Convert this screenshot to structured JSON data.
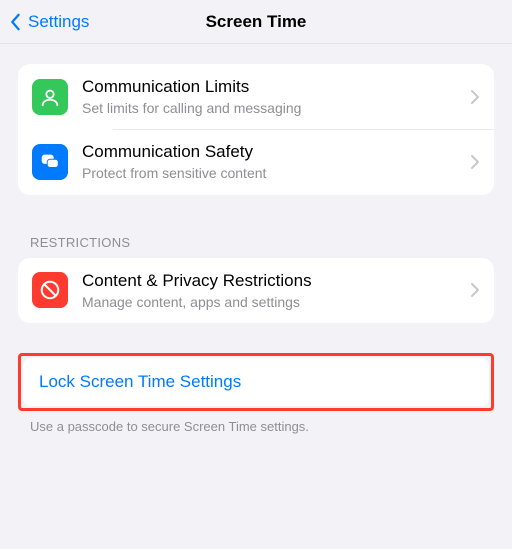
{
  "nav": {
    "back_label": "Settings",
    "title": "Screen Time"
  },
  "group1": {
    "items": [
      {
        "title": "Communication Limits",
        "subtitle": "Set limits for calling and messaging",
        "icon": "contact-icon",
        "color": "green"
      },
      {
        "title": "Communication Safety",
        "subtitle": "Protect from sensitive content",
        "icon": "chat-bubbles-icon",
        "color": "blue"
      }
    ]
  },
  "restrictions": {
    "header": "RESTRICTIONS",
    "items": [
      {
        "title": "Content & Privacy Restrictions",
        "subtitle": "Manage content, apps and settings",
        "icon": "no-entry-icon",
        "color": "red"
      }
    ]
  },
  "lock": {
    "label": "Lock Screen Time Settings",
    "footer": "Use a passcode to secure Screen Time settings."
  }
}
